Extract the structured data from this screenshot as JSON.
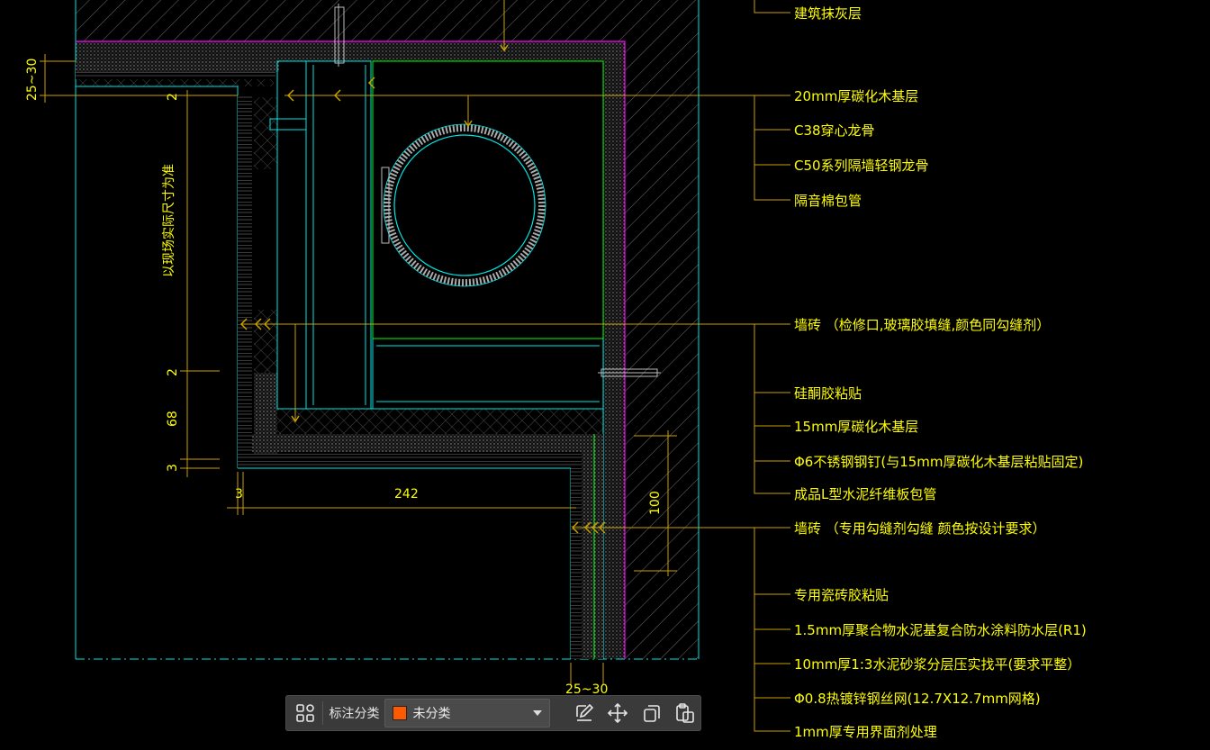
{
  "colors": {
    "background": "#000000",
    "annotation": "#ffff00",
    "magenta": "#ff00ff",
    "cyan": "#00e5e5",
    "green": "#00ff00",
    "leader": "#c8a000",
    "swatch": "#ff5a00"
  },
  "drawing": {
    "notes": [
      "建筑抹灰层",
      "20mm厚碳化木基层",
      "C38穿心龙骨",
      "C50系列隔墙轻钢龙骨",
      "隔音棉包管",
      "墙砖 （检修口,玻璃胶填缝,颜色同勾缝剂）",
      "硅酮胶粘贴",
      "15mm厚碳化木基层",
      "Φ6不锈钢钢钉(与15mm厚碳化木基层粘贴固定)",
      "成品L型水泥纤维板包管",
      "墙砖 （专用勾缝剂勾缝 颜色按设计要求）",
      "专用瓷砖胶粘贴",
      "1.5mm厚聚合物水泥基复合防水涂料防水层(R1)",
      "10mm厚1:3水泥砂浆分层压实找平(要求平整）",
      "Φ0.8热镀锌钢丝网(12.7X12.7mm网格)",
      "1mm厚专用界面剂处理"
    ],
    "dimensions": {
      "top_left": "25~30",
      "vertical_text": "以现场实际尺寸为准",
      "d2a": "2",
      "d2b": "2",
      "d68": "68",
      "d3v": "3",
      "d3h": "3",
      "d242": "242",
      "d100": "100",
      "bottom": "25~30"
    }
  },
  "toolbar": {
    "classify_label": "标注分类",
    "selected_category": "未分类",
    "icons": [
      "grid-icon",
      "edit-icon",
      "move-icon",
      "copy-icon",
      "paste-icon"
    ]
  }
}
